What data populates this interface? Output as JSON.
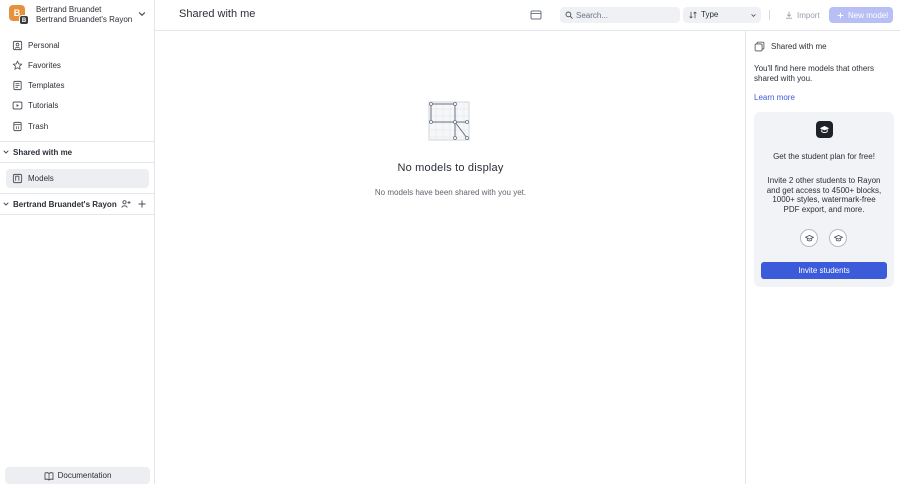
{
  "account": {
    "avatar_letter": "B",
    "avatar_sub_letter": "B",
    "name": "Bertrand Bruandet",
    "org": "Bertrand Bruandet's Rayon"
  },
  "sidebar": {
    "items": [
      {
        "label": "Personal",
        "icon": "person-folder-icon"
      },
      {
        "label": "Favorites",
        "icon": "star-icon"
      },
      {
        "label": "Templates",
        "icon": "template-icon"
      },
      {
        "label": "Tutorials",
        "icon": "play-icon"
      },
      {
        "label": "Trash",
        "icon": "trash-icon"
      }
    ],
    "shared_section": "Shared with me",
    "models_item": "Models",
    "org_section": "Bertrand Bruandet's Rayon",
    "documentation": "Documentation"
  },
  "header": {
    "title": "Shared with me",
    "search_placeholder": "Search...",
    "type_filter": "Type",
    "import_label": "Import",
    "new_model_label": "New model"
  },
  "empty_state": {
    "title": "No models to display",
    "subtitle": "No models have been shared with you yet."
  },
  "right_panel": {
    "title": "Shared with me",
    "description": "You'll find here models that others shared with you.",
    "learn_more": "Learn more",
    "promo_title": "Get the student plan for free!",
    "promo_body": "Invite 2 other students to Rayon and get access to 4500+ blocks, 1000+ styles, watermark-free PDF export, and more.",
    "invite_button": "Invite students"
  },
  "colors": {
    "accent": "#3b5bdb",
    "avatar": "#e8913c",
    "new_model_disabled": "#b7bff5"
  }
}
